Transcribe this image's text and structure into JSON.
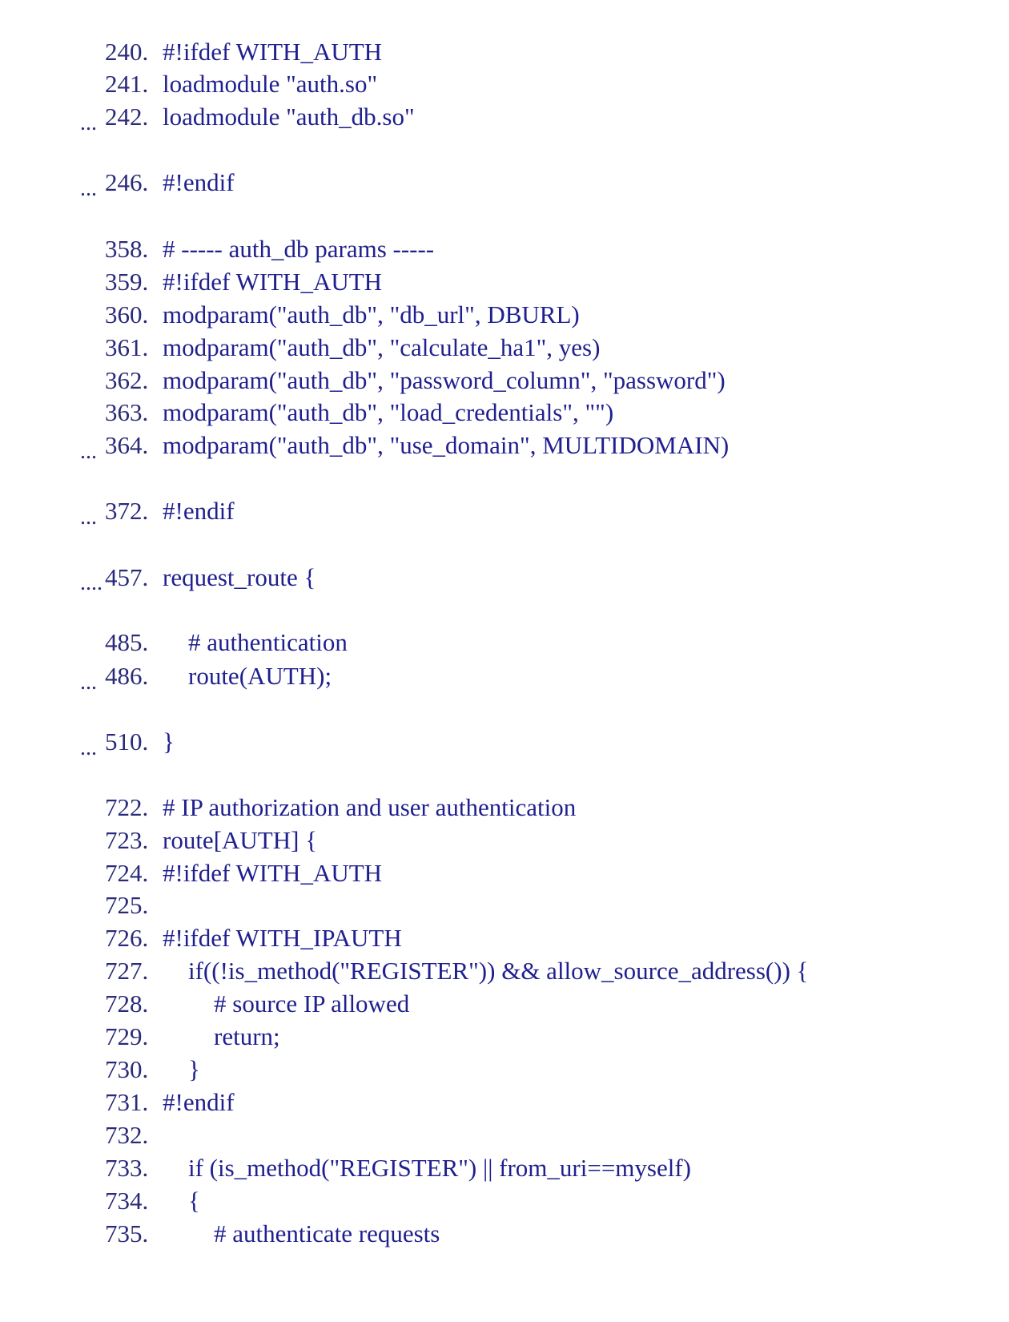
{
  "ellipsis": "...",
  "ellipsis4": "....",
  "lines": {
    "l240": {
      "num": "240.",
      "code": "#!ifdef WITH_AUTH"
    },
    "l241": {
      "num": "241.",
      "code": "loadmodule \"auth.so\""
    },
    "l242": {
      "num": "242.",
      "code": "loadmodule \"auth_db.so\""
    },
    "l246": {
      "num": "246.",
      "code": "#!endif"
    },
    "l358": {
      "num": "358.",
      "code": "# ----- auth_db params -----"
    },
    "l359": {
      "num": "359.",
      "code": "#!ifdef WITH_AUTH"
    },
    "l360": {
      "num": "360.",
      "code": "modparam(\"auth_db\", \"db_url\", DBURL)"
    },
    "l361": {
      "num": "361.",
      "code": "modparam(\"auth_db\", \"calculate_ha1\", yes)"
    },
    "l362": {
      "num": "362.",
      "code": "modparam(\"auth_db\", \"password_column\", \"password\")"
    },
    "l363": {
      "num": "363.",
      "code": "modparam(\"auth_db\", \"load_credentials\", \"\")"
    },
    "l364": {
      "num": "364.",
      "code": "modparam(\"auth_db\", \"use_domain\", MULTIDOMAIN)"
    },
    "l372": {
      "num": "372.",
      "code": "#!endif"
    },
    "l457": {
      "num": "457.",
      "code": "request_route {"
    },
    "l485": {
      "num": "485.",
      "code": "# authentication"
    },
    "l486": {
      "num": "486.",
      "code": "route(AUTH);"
    },
    "l510": {
      "num": "510.",
      "code": "}"
    },
    "l722": {
      "num": "722.",
      "code": "# IP authorization and user authentication"
    },
    "l723": {
      "num": "723.",
      "code": "route[AUTH] {"
    },
    "l724": {
      "num": "724.",
      "code": "#!ifdef WITH_AUTH"
    },
    "l725": {
      "num": "725.",
      "code": ""
    },
    "l726": {
      "num": "726.",
      "code": "#!ifdef WITH_IPAUTH"
    },
    "l727": {
      "num": "727.",
      "code": "if((!is_method(\"REGISTER\")) && allow_source_address()) {"
    },
    "l728": {
      "num": "728.",
      "code": "# source IP allowed"
    },
    "l729": {
      "num": "729.",
      "code": "return;"
    },
    "l730": {
      "num": "730.",
      "code": "}"
    },
    "l731": {
      "num": "731.",
      "code": "#!endif"
    },
    "l732": {
      "num": "732.",
      "code": ""
    },
    "l733": {
      "num": "733.",
      "code": "if (is_method(\"REGISTER\") || from_uri==myself)"
    },
    "l734": {
      "num": "734.",
      "code": "{"
    },
    "l735": {
      "num": "735.",
      "code": "# authenticate requests"
    }
  }
}
